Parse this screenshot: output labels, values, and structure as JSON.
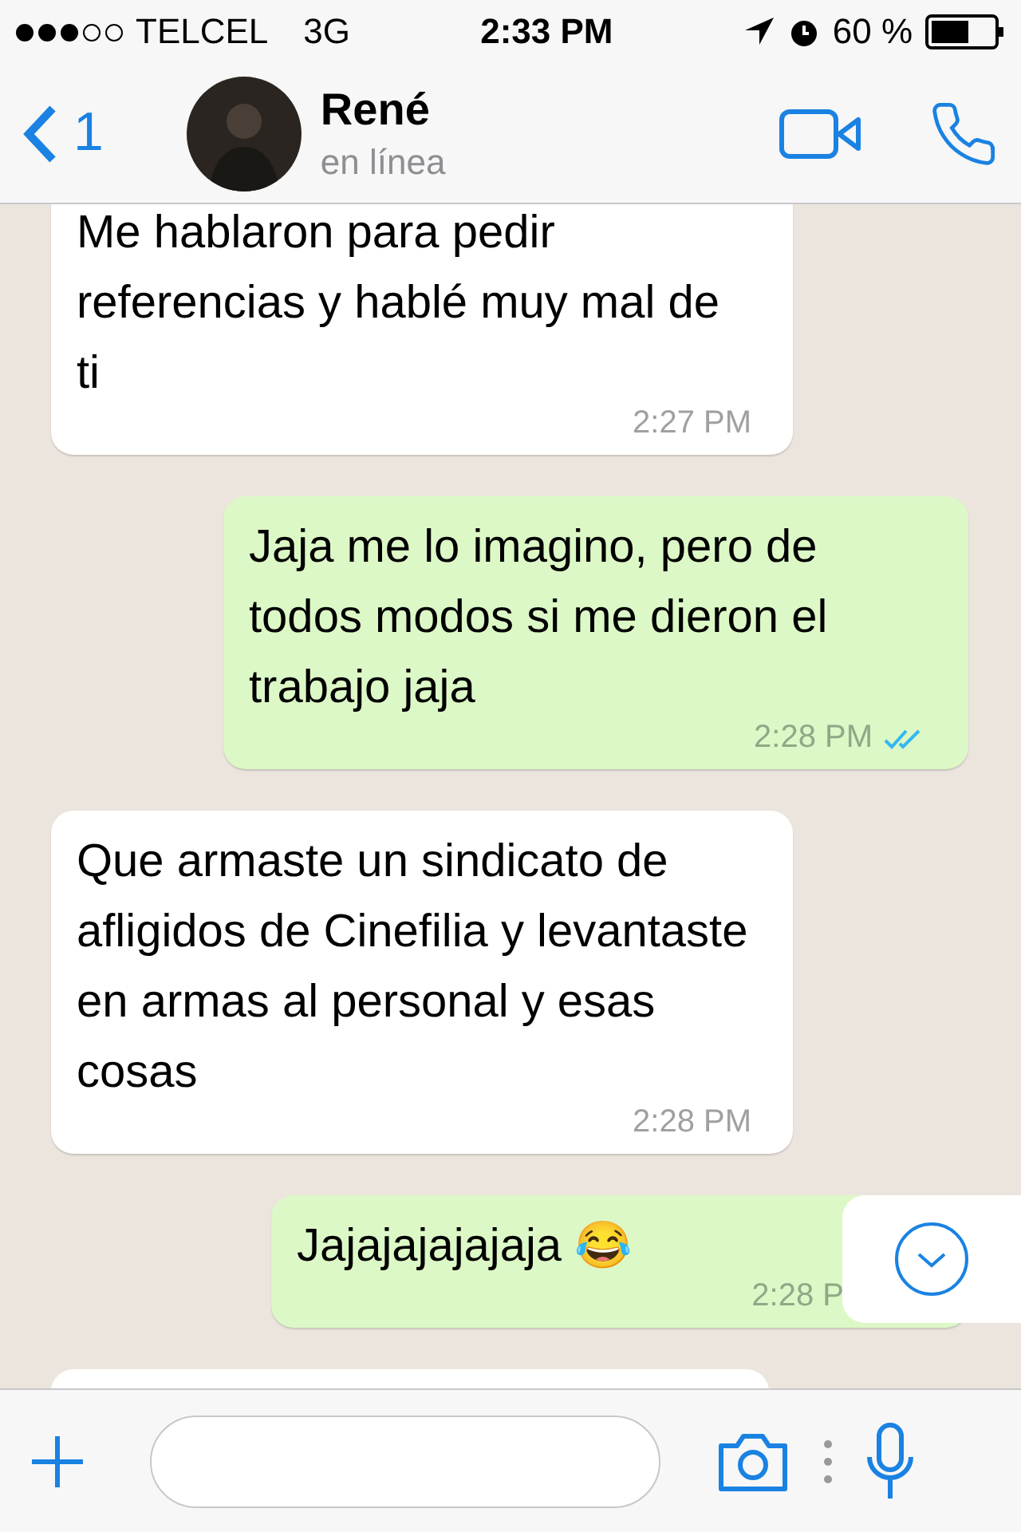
{
  "status_bar": {
    "carrier": "TELCEL",
    "network": "3G",
    "time": "2:33 PM",
    "battery": "60 %"
  },
  "header": {
    "back_count": "1",
    "contact_name": "René",
    "contact_status": "en línea"
  },
  "messages": [
    {
      "kind": "incoming",
      "text": "Me hablaron para pedir referencias y hablé muy mal de ti",
      "time": "2:27 PM"
    },
    {
      "kind": "outgoing",
      "text": "Jaja me lo imagino, pero de todos modos si me dieron el trabajo jaja",
      "time": "2:28 PM",
      "read": true
    },
    {
      "kind": "incoming",
      "text": "Que armaste un sindicato de afligidos de Cinefilia y levantaste en armas al personal y esas cosas",
      "time": "2:28 PM"
    },
    {
      "kind": "outgoing",
      "text": "Jajajajajajaja 😂",
      "time": "2:28 P"
    }
  ]
}
